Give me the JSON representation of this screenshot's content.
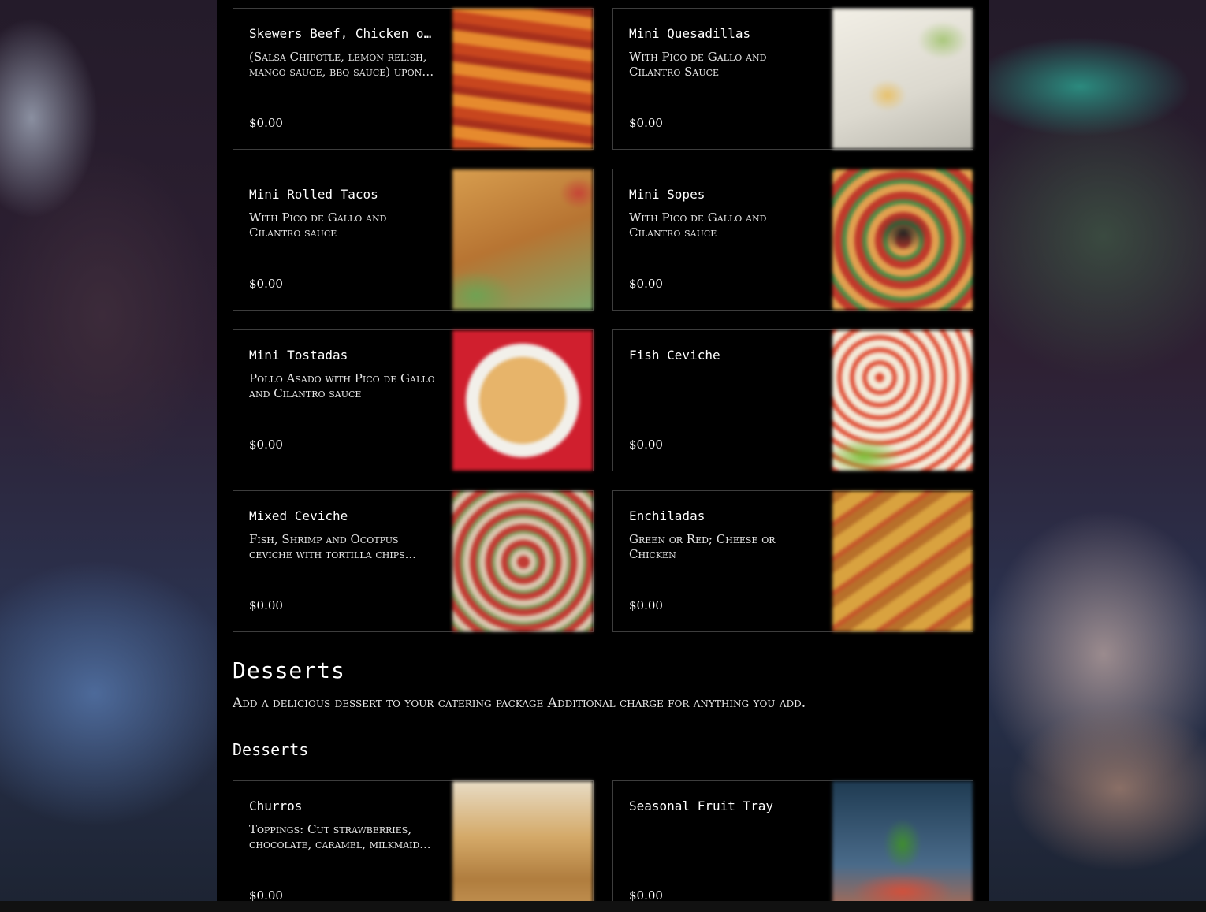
{
  "menu": {
    "cards": [
      {
        "name": "Skewers Beef, Chicken or Shrimp",
        "description": "(Salsa Chipotle, lemon relish, mango sauce, bbq sauce) upon request",
        "price": "$0.00",
        "photo": "skewers-photo"
      },
      {
        "name": "Mini Quesadillas",
        "description": "With Pico de Gallo and Cilantro Sauce",
        "price": "$0.00",
        "photo": "quesadillas-photo"
      },
      {
        "name": "Mini Rolled Tacos",
        "description": "With Pico de Gallo and Cilantro sauce",
        "price": "$0.00",
        "photo": "rolled-tacos-photo"
      },
      {
        "name": "Mini Sopes",
        "description": "With Pico de Gallo and Cilantro sauce",
        "price": "$0.00",
        "photo": "sopes-photo"
      },
      {
        "name": "Mini Tostadas",
        "description": "Pollo Asado with Pico de Gallo and Cilantro sauce",
        "price": "$0.00",
        "photo": "tostadas-photo"
      },
      {
        "name": "Fish Ceviche",
        "description": "",
        "price": "$0.00",
        "photo": "fish-ceviche-photo"
      },
      {
        "name": "Mixed Ceviche",
        "description": "Fish, Shrimp and Ocotpus ceviche with tortilla chips...",
        "price": "$0.00",
        "photo": "mixed-ceviche-photo"
      },
      {
        "name": "Enchiladas",
        "description": "Green or Red;  Cheese or Chicken",
        "price": "$0.00",
        "photo": "enchiladas-photo"
      }
    ]
  },
  "desserts": {
    "title": "Desserts",
    "description": "Add a delicious dessert to your catering package Additional charge for anything you add.",
    "subsection_title": "Desserts",
    "cards": [
      {
        "name": "Churros",
        "description": "Toppings: Cut strawberries, chocolate, caramel, milkmaid...",
        "price": "$0.00",
        "photo": "churros-photo"
      },
      {
        "name": "Seasonal Fruit Tray",
        "description": "",
        "price": "$0.00",
        "photo": "fruit-tray-photo"
      }
    ]
  }
}
